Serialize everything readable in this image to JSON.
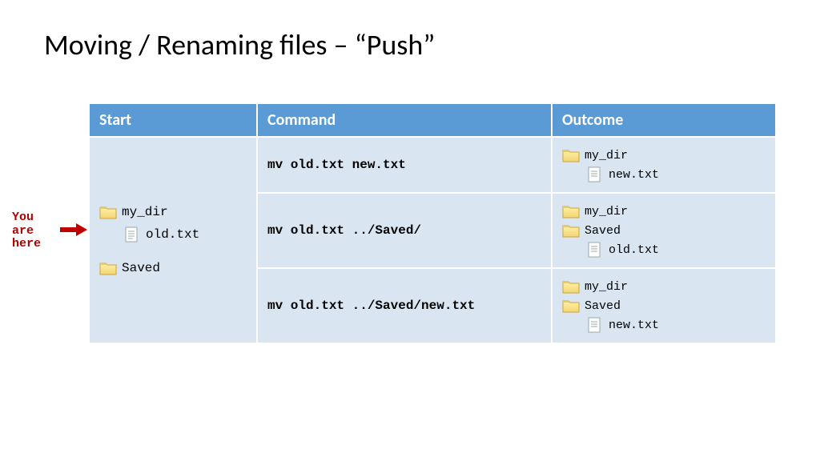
{
  "title": "Moving / Renaming files – “Push”",
  "pointer": {
    "line1": "You",
    "line2": "are",
    "line3": "here"
  },
  "headers": {
    "start": "Start",
    "command": "Command",
    "outcome": "Outcome"
  },
  "start_tree": {
    "n0": "my_dir",
    "n1": "old.txt",
    "n2": "Saved"
  },
  "rows": [
    {
      "command": "mv old.txt new.txt",
      "outcome": {
        "n0": "my_dir",
        "n1": "new.txt"
      }
    },
    {
      "command": "mv old.txt ../Saved/",
      "outcome": {
        "n0": "my_dir",
        "n1": "Saved",
        "n2": "old.txt"
      }
    },
    {
      "command": "mv old.txt ../Saved/new.txt",
      "outcome": {
        "n0": "my_dir",
        "n1": "Saved",
        "n2": "new.txt"
      }
    }
  ]
}
